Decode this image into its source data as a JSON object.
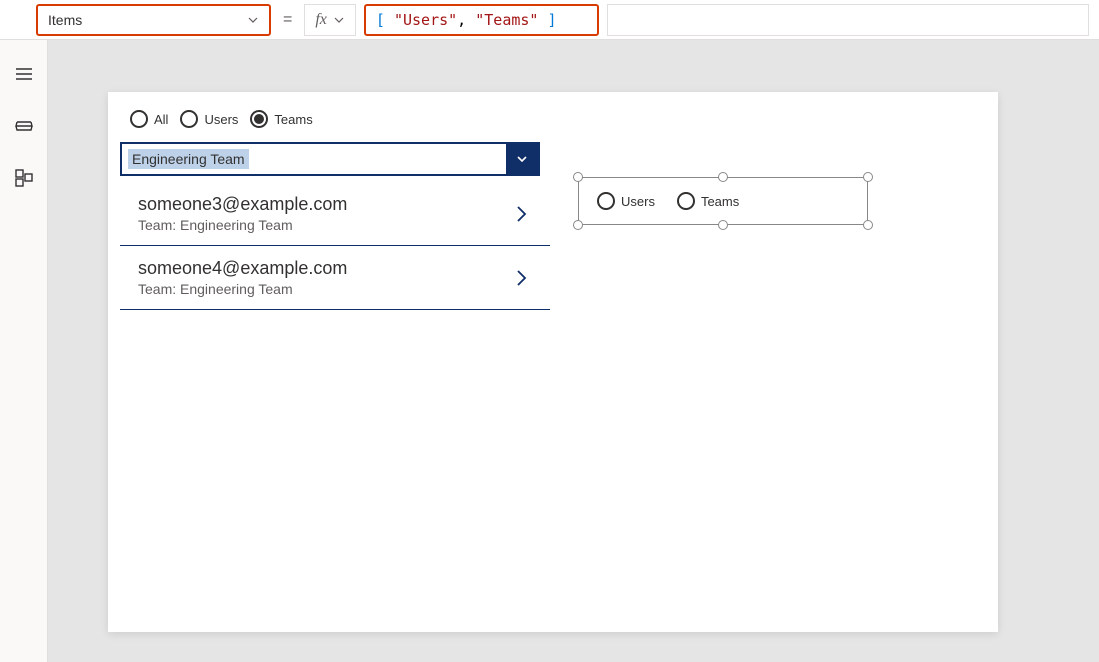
{
  "formula_bar": {
    "property_label": "Items",
    "equals": "=",
    "fx_label": "fx",
    "formula": {
      "open_bracket": "[",
      "string1": "\"Users\"",
      "comma": ",",
      "string2": "\"Teams\"",
      "close_bracket": "]"
    }
  },
  "left_rail": {
    "hamburger": "hamburger-icon",
    "tree": "tree-icon",
    "components": "components-icon"
  },
  "app": {
    "radio1": {
      "options": [
        {
          "label": "All",
          "selected": false
        },
        {
          "label": "Users",
          "selected": false
        },
        {
          "label": "Teams",
          "selected": true
        }
      ]
    },
    "combobox": {
      "value": "Engineering Team"
    },
    "gallery": [
      {
        "title": "someone3@example.com",
        "sub": "Team: Engineering Team"
      },
      {
        "title": "someone4@example.com",
        "sub": "Team: Engineering Team"
      }
    ],
    "selected_radio": {
      "options": [
        {
          "label": "Users"
        },
        {
          "label": "Teams"
        }
      ]
    }
  }
}
